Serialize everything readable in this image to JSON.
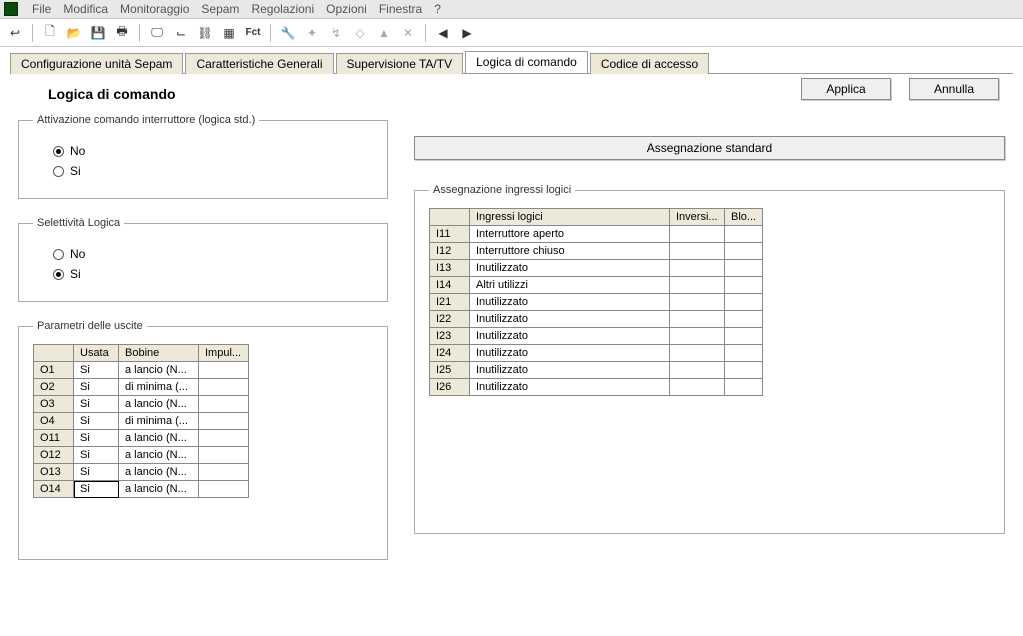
{
  "menu": [
    "File",
    "Modifica",
    "Monitoraggio",
    "Sepam",
    "Regolazioni",
    "Opzioni",
    "Finestra",
    "?"
  ],
  "tabs": {
    "items": [
      "Configurazione unità Sepam",
      "Caratteristiche Generali",
      "Supervisione TA/TV",
      "Logica di comando",
      "Codice di accesso"
    ],
    "active": 3
  },
  "page_title": "Logica di comando",
  "buttons": {
    "apply": "Applica",
    "cancel": "Annulla",
    "assign_std": "Assegnazione standard"
  },
  "group_activation": {
    "legend": "Attivazione comando interruttore (logica std.)",
    "no": "No",
    "si": "Si",
    "selected": "No"
  },
  "group_selectivity": {
    "legend": "Selettività Logica",
    "no": "No",
    "si": "Si",
    "selected": "Si"
  },
  "group_outputs": {
    "legend": "Parametri delle uscite",
    "headers": {
      "blank": "",
      "usata": "Usata",
      "bobine": "Bobine",
      "impul": "Impul..."
    },
    "rows": [
      {
        "id": "O1",
        "usata": "Si",
        "bobine": "a lancio (N...",
        "impul": ""
      },
      {
        "id": "O2",
        "usata": "Si",
        "bobine": "di minima (...",
        "impul": ""
      },
      {
        "id": "O3",
        "usata": "Si",
        "bobine": "a lancio (N...",
        "impul": ""
      },
      {
        "id": "O4",
        "usata": "Si",
        "bobine": "di minima (...",
        "impul": ""
      },
      {
        "id": "O11",
        "usata": "Si",
        "bobine": "a lancio (N...",
        "impul": ""
      },
      {
        "id": "O12",
        "usata": "Si",
        "bobine": "a lancio (N...",
        "impul": ""
      },
      {
        "id": "O13",
        "usata": "Si",
        "bobine": "a lancio (N...",
        "impul": ""
      },
      {
        "id": "O14",
        "usata": "Si",
        "bobine": "a lancio (N...",
        "impul": ""
      }
    ],
    "selected_row": 7
  },
  "group_inputs": {
    "legend": "Assegnazione ingressi logici",
    "headers": {
      "blank": "",
      "il": "Ingressi logici",
      "inv": "Inversi...",
      "blo": "Blo..."
    },
    "rows": [
      {
        "id": "I11",
        "il": "Interruttore aperto",
        "inv": "",
        "blo": ""
      },
      {
        "id": "I12",
        "il": "Interruttore chiuso",
        "inv": "",
        "blo": ""
      },
      {
        "id": "I13",
        "il": "Inutilizzato",
        "inv": "",
        "blo": ""
      },
      {
        "id": "I14",
        "il": "Altri utilizzi",
        "inv": "",
        "blo": ""
      },
      {
        "id": "I21",
        "il": "Inutilizzato",
        "inv": "",
        "blo": ""
      },
      {
        "id": "I22",
        "il": "Inutilizzato",
        "inv": "",
        "blo": ""
      },
      {
        "id": "I23",
        "il": "Inutilizzato",
        "inv": "",
        "blo": ""
      },
      {
        "id": "I24",
        "il": "Inutilizzato",
        "inv": "",
        "blo": ""
      },
      {
        "id": "I25",
        "il": "Inutilizzato",
        "inv": "",
        "blo": ""
      },
      {
        "id": "I26",
        "il": "Inutilizzato",
        "inv": "",
        "blo": ""
      }
    ]
  }
}
